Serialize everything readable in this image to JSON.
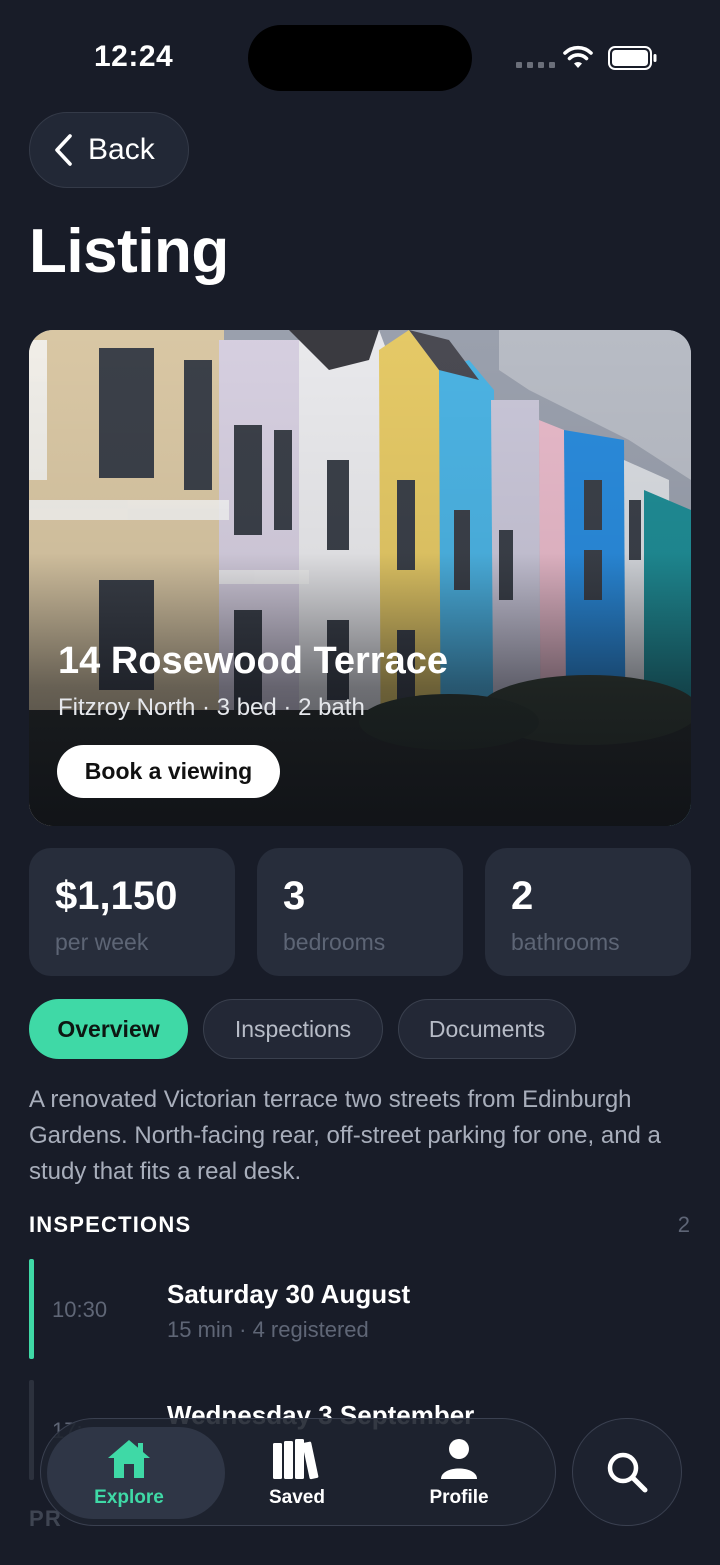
{
  "status": {
    "time": "12:24"
  },
  "nav": {
    "back_label": "Back",
    "title": "Listing"
  },
  "hero": {
    "title": "14 Rosewood Terrace",
    "subtitle": "Fitzroy North · 3 bed · 2 bath",
    "cta": "Book a viewing"
  },
  "stats": [
    {
      "value": "$1,150",
      "label": "per week"
    },
    {
      "value": "3",
      "label": "bedrooms"
    },
    {
      "value": "2",
      "label": "bathrooms"
    }
  ],
  "tabs": [
    {
      "label": "Overview",
      "active": true
    },
    {
      "label": "Inspections",
      "active": false
    },
    {
      "label": "Documents",
      "active": false
    }
  ],
  "description": "A renovated Victorian terrace two streets from Edinburgh Gardens. North-facing rear, off-street parking for one, and a study that fits a real desk.",
  "inspections": {
    "heading": "INSPECTIONS",
    "count": "2",
    "items": [
      {
        "time": "10:30",
        "date": "Saturday 30 August",
        "meta": "15 min · 4 registered"
      },
      {
        "time": "17:",
        "date": "Wednesday 3 September",
        "meta": ""
      }
    ]
  },
  "next_section": "PR",
  "tabbar": {
    "items": [
      {
        "label": "Explore",
        "icon": "home-icon",
        "active": true
      },
      {
        "label": "Saved",
        "icon": "books-icon",
        "active": false
      },
      {
        "label": "Profile",
        "icon": "person-icon",
        "active": false
      }
    ],
    "search_icon": "search-icon"
  },
  "colors": {
    "accent": "#3fd9a6",
    "background": "#181c28",
    "card": "#272d3b"
  }
}
